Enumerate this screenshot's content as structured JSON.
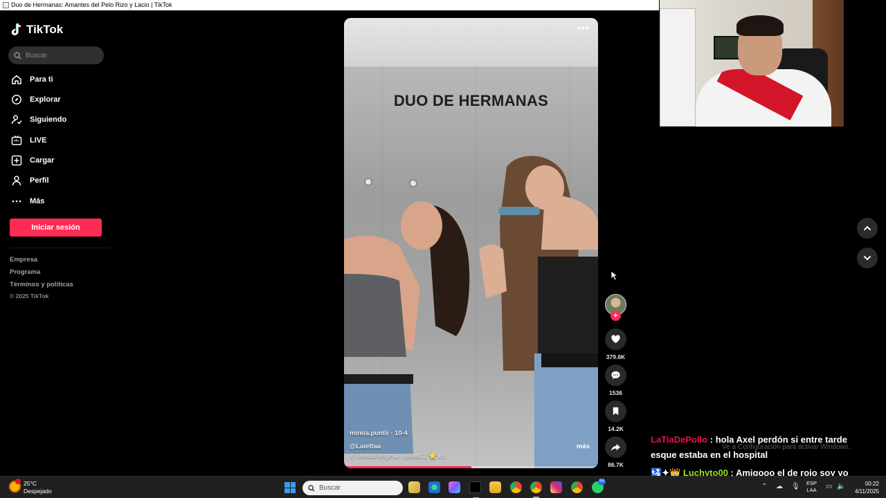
{
  "window": {
    "title": "Duo de Hermanas: Amantes del Pelo Rizo y Lacio | TikTok"
  },
  "sidebar": {
    "logo_text": "TikTok",
    "search_placeholder": "Buscar",
    "nav": [
      {
        "label": "Para ti",
        "icon": "home-icon"
      },
      {
        "label": "Explorar",
        "icon": "compass-icon"
      },
      {
        "label": "Siguiendo",
        "icon": "following-icon"
      },
      {
        "label": "LIVE",
        "icon": "live-icon"
      },
      {
        "label": "Cargar",
        "icon": "upload-icon"
      },
      {
        "label": "Perfil",
        "icon": "profile-icon"
      },
      {
        "label": "Más",
        "icon": "more-icon"
      }
    ],
    "login_label": "Iniciar sesión",
    "footer": [
      "Empresa",
      "Programa",
      "Términos y políticas"
    ],
    "copyright": "© 2025 TikTok"
  },
  "video": {
    "overlay_text": "DUO DE HERMANAS",
    "author_line": "mireia.puntii · 10-4",
    "mention": "@Laiettaa",
    "sound": "♫  sonido original - julieta'2 ⭐ co",
    "more_label": "más",
    "progress": 0.5
  },
  "actions": {
    "likes": "379.6K",
    "comments": "1536",
    "saves": "14.2K",
    "shares": "86.7K"
  },
  "chat": [
    {
      "user": "LaTiaDePollo",
      "text": ": hola Axel perdón si entre tarde",
      "text2": "esque estaba en el hospital"
    },
    {
      "prefix": "🛂✦👑",
      "user": "Luchyto00",
      "text": ": Amigooo el de rojo soy yo"
    }
  ],
  "windows_notice": "Ve a Configuración para activar Windows.",
  "taskbar": {
    "weather_temp": "25°C",
    "weather_desc": "Despejado",
    "search_placeholder": "Buscar",
    "whatsapp_badge": "54",
    "lang_line1": "ESP",
    "lang_line2": "LAA",
    "time": "00:22",
    "date": "4/11/2025"
  }
}
